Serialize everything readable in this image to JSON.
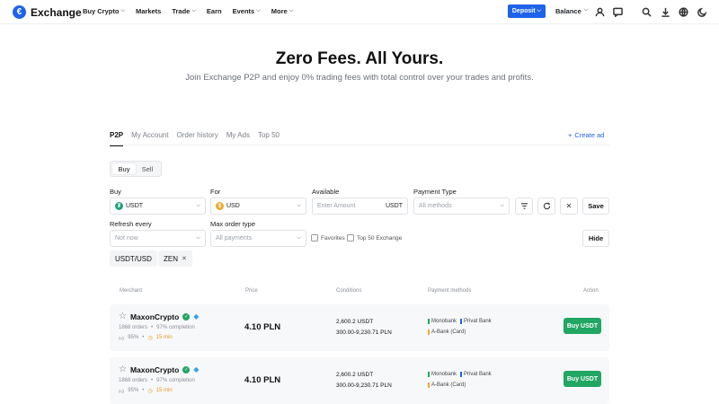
{
  "nav": {
    "logo_text": "Exchange",
    "menu": [
      {
        "label": "Buy Crypto",
        "caret": true
      },
      {
        "label": "Markets",
        "caret": false
      },
      {
        "label": "Trade",
        "caret": true
      },
      {
        "label": "Earn",
        "caret": false
      },
      {
        "label": "Events",
        "caret": true
      },
      {
        "label": "More",
        "caret": true
      }
    ],
    "deposit_label": "Deposit",
    "balance_label": "Balance"
  },
  "hero": {
    "title": "Zero Fees. All Yours.",
    "subtitle": "Join Exchange P2P and enjoy 0% trading fees with total control over your trades and profits."
  },
  "tabs": [
    "P2P",
    "My Account",
    "Order history",
    "My Ads",
    "Top 50"
  ],
  "create_ad": "Create ad",
  "toggle": {
    "buy": "Buy",
    "sell": "Sell"
  },
  "filters": {
    "buy_label": "Buy",
    "buy_value": "USDT",
    "for_label": "For",
    "for_value": "USD",
    "available_label": "Available",
    "available_placeholder": "Enter Amount",
    "available_unit": "USDT",
    "payment_label": "Payment Type",
    "payment_value": "All methods",
    "save_label": "Save",
    "refresh_label": "Refresh every",
    "refresh_value": "Not now",
    "max_order_label": "Max order type",
    "max_order_value": "All payments",
    "favorites_label": "Favorites",
    "top50_label": "Top 50 Exchange",
    "hide_label": "Hide"
  },
  "chips": {
    "pair": "USDT/USD",
    "zen": "ZEN"
  },
  "table": {
    "headers": {
      "merchant": "Merchant",
      "price": "Price",
      "conditions": "Conditions",
      "payment": "Payment methods",
      "action": "Action"
    },
    "rows": [
      {
        "name": "MaxonCrypto",
        "orders": "1868 orders",
        "completion": "97% completion",
        "rating": "95%",
        "time": "15 min",
        "price": "4.10 PLN",
        "amount": "2,600.2 USDT",
        "limit": "300.00-9,230.71 PLN",
        "pay1": "Monobank",
        "pay2": "Privat Bank",
        "pay3": "A-Bank (Card)",
        "action": "Buy USDT"
      },
      {
        "name": "MaxonCrypto",
        "orders": "1868 orders",
        "completion": "97% completion",
        "rating": "95%",
        "time": "15 min",
        "price": "4.10 PLN",
        "amount": "2,600.2 USDT",
        "limit": "300.00-9,230.71 PLN",
        "pay1": "Monobank",
        "pay2": "Privat Bank",
        "pay3": "A-Bank (Card)",
        "action": "Buy USDT"
      }
    ]
  },
  "colors": {
    "accent": "#1e63e9",
    "buy": "#21a663",
    "pay_green": "#21a663",
    "pay_blue": "#1e63e9",
    "pay_orange": "#f0a830"
  }
}
